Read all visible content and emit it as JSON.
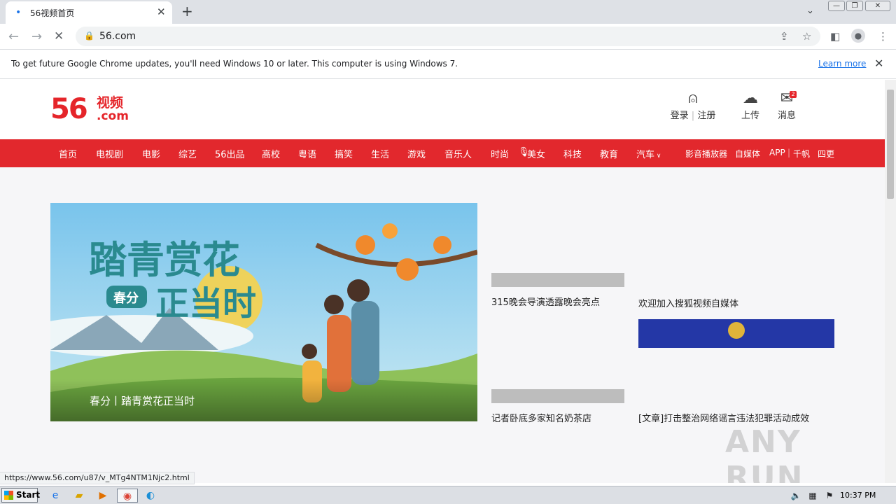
{
  "browser": {
    "tab_title": "56视频首页",
    "address": "56.com",
    "infobar_message": "To get future Google Chrome updates, you'll need Windows 10 or later. This computer is using Windows 7.",
    "infobar_link": "Learn more",
    "status_url": "https://www.56.com/u87/v_MTg4NTM1Njc2.html"
  },
  "header": {
    "logo_number": "56",
    "logo_cn": "视频",
    "logo_com": ".com",
    "login": "登录",
    "register": "注册",
    "upload": "上传",
    "messages": "消息",
    "message_count": "2"
  },
  "nav": {
    "items": [
      "首页",
      "电视剧",
      "电影",
      "综艺",
      "56出品",
      "高校",
      "粤语",
      "搞笑",
      "生活",
      "游戏",
      "音乐人",
      "时尚",
      "美女",
      "科技",
      "教育",
      "汽车"
    ],
    "right_items": [
      "影音播放器",
      "自媒体",
      "APP",
      "千帆",
      "四更"
    ]
  },
  "content": {
    "banner_caption": "春分丨踏青赏花正当时",
    "banner_art_title_1": "踏青赏花",
    "banner_art_title_2": "正当时",
    "banner_art_tag": "春分",
    "items": [
      {
        "title": "315晚会导演透露晚会亮点"
      },
      {
        "title": "欢迎加入搜狐视频自媒体"
      },
      {
        "title": "记者卧底多家知名奶茶店"
      },
      {
        "title": "[文章]打击整治网络谣言违法犯罪活动成效"
      }
    ]
  },
  "taskbar": {
    "start": "Start",
    "clock": "10:37 PM"
  },
  "watermark": "ANY RUN",
  "colors": {
    "brand_red": "#e2282d"
  }
}
